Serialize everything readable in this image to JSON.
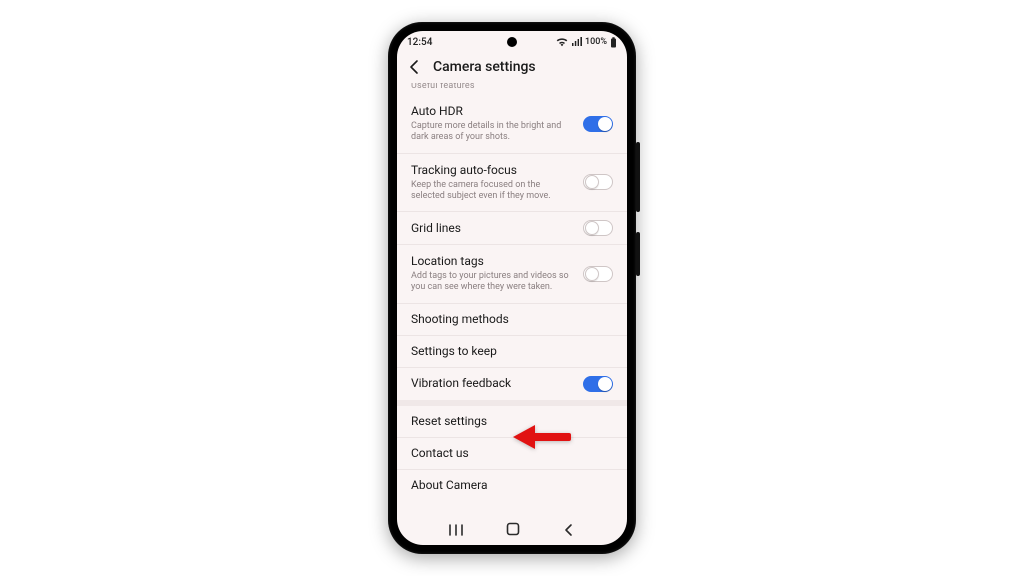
{
  "status": {
    "time": "12:54",
    "battery_text": "100%"
  },
  "appbar": {
    "title": "Camera settings"
  },
  "section_header_partial": "Useful features",
  "rows": {
    "auto_hdr": {
      "title": "Auto HDR",
      "sub": "Capture more details in the bright and dark areas of your shots.",
      "on": true
    },
    "tracking_af": {
      "title": "Tracking auto-focus",
      "sub": "Keep the camera focused on the selected subject even if they move.",
      "on": false
    },
    "grid": {
      "title": "Grid lines",
      "on": false
    },
    "location": {
      "title": "Location tags",
      "sub": "Add tags to your pictures and videos so you can see where they were taken.",
      "on": false
    },
    "shooting": {
      "title": "Shooting methods"
    },
    "keep": {
      "title": "Settings to keep"
    },
    "vibration": {
      "title": "Vibration feedback",
      "on": true
    },
    "reset": {
      "title": "Reset settings"
    },
    "contact": {
      "title": "Contact us"
    },
    "about": {
      "title": "About Camera"
    }
  },
  "annotation": {
    "points_to": "reset-settings-row",
    "color": "#e11212"
  }
}
